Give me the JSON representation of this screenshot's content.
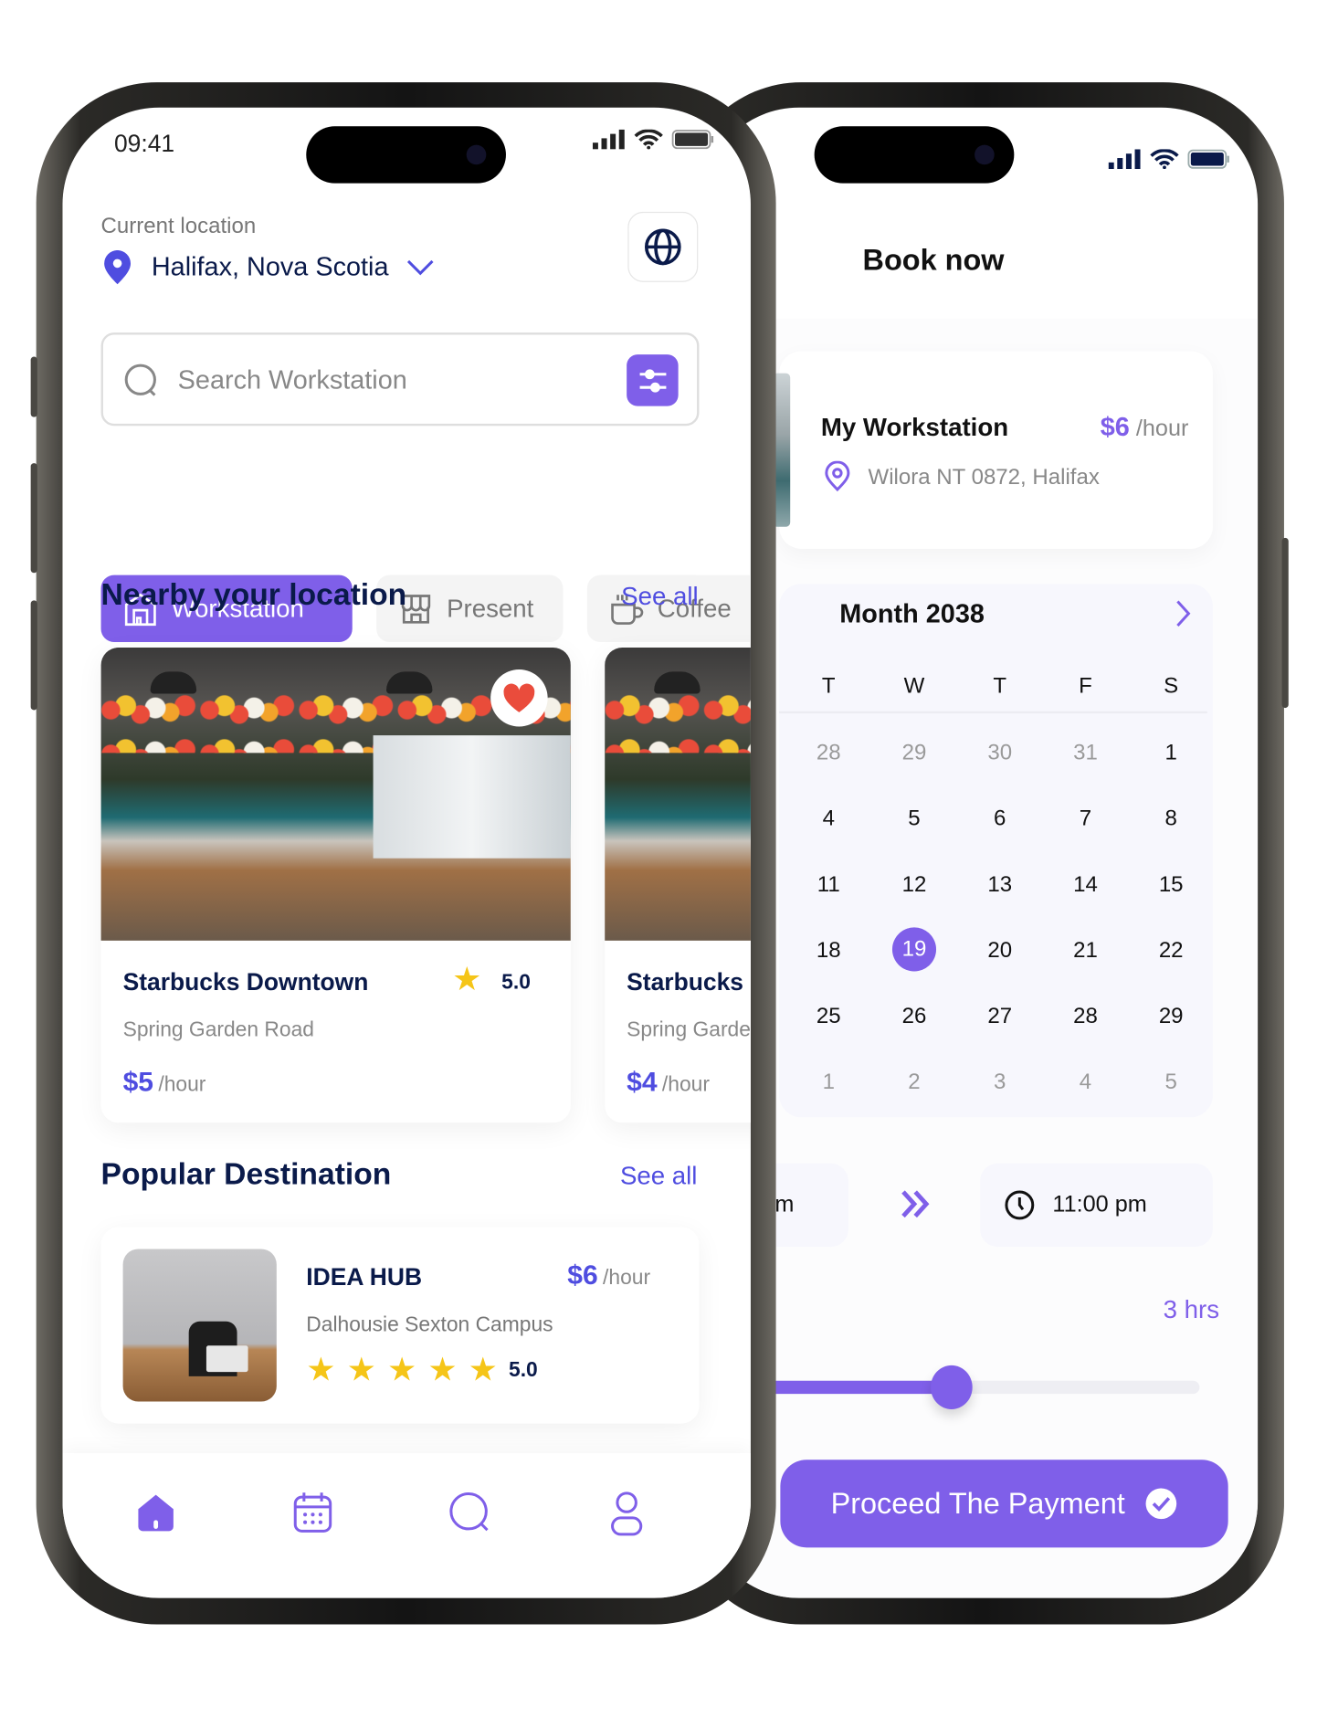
{
  "colors": {
    "accent": "#7f5fe9",
    "navy": "#0a1a4a",
    "heart": "#ea4c3c",
    "star": "#f5c518"
  },
  "left_phone": {
    "status": {
      "time": "09:41",
      "icons": [
        "signal-icon",
        "wifi-icon",
        "battery-icon"
      ]
    },
    "location": {
      "label": "Current location",
      "value": "Halifax, Nova Scotia",
      "icon": "map-pin-icon"
    },
    "globe_button": {
      "icon": "globe-icon"
    },
    "search": {
      "placeholder": "Search Workstation",
      "filter_icon": "sliders-icon"
    },
    "categories": [
      {
        "label": "Workstation",
        "icon": "building-icon",
        "selected": true
      },
      {
        "label": "Present",
        "icon": "store-icon",
        "selected": false
      },
      {
        "label": "Coffee",
        "icon": "coffee-icon",
        "selected": false
      }
    ],
    "nearby": {
      "title": "Nearby your location",
      "see_all": "See all",
      "cards": [
        {
          "name": "Starbucks Downtown",
          "rating": "5.0",
          "address": "Spring Garden Road",
          "price": "$5",
          "unit": "/hour",
          "favorite": true
        },
        {
          "name": "Starbucks",
          "address": "Spring Garde",
          "price": "$4",
          "unit": "/hour"
        }
      ]
    },
    "popular": {
      "title": "Popular Destination",
      "see_all": "See all",
      "items": [
        {
          "name": "IDEA HUB",
          "price": "$6",
          "unit": "/hour",
          "address": "Dalhousie Sexton Campus",
          "rating": "5.0",
          "stars": 5
        }
      ]
    },
    "bottom_nav": [
      {
        "icon": "home-icon",
        "active": true
      },
      {
        "icon": "calendar-icon",
        "active": false
      },
      {
        "icon": "search-icon",
        "active": false
      },
      {
        "icon": "profile-icon",
        "active": false
      }
    ]
  },
  "right_phone": {
    "title": "Book now",
    "workstation": {
      "name": "My Workstation",
      "price": "$6",
      "unit": "/hour",
      "address": "Wilora NT 0872, Halifax"
    },
    "calendar": {
      "month_label": "Month 2038",
      "weekdays": [
        "T",
        "W",
        "T",
        "F",
        "S"
      ],
      "weeks": [
        [
          {
            "d": "28",
            "m": true
          },
          {
            "d": "29",
            "m": true
          },
          {
            "d": "30",
            "m": true
          },
          {
            "d": "31",
            "m": true
          },
          {
            "d": "1"
          }
        ],
        [
          {
            "d": "4"
          },
          {
            "d": "5"
          },
          {
            "d": "6"
          },
          {
            "d": "7"
          },
          {
            "d": "8"
          }
        ],
        [
          {
            "d": "11"
          },
          {
            "d": "12"
          },
          {
            "d": "13"
          },
          {
            "d": "14"
          },
          {
            "d": "15"
          }
        ],
        [
          {
            "d": "18"
          },
          {
            "d": "19",
            "s": true
          },
          {
            "d": "20"
          },
          {
            "d": "21"
          },
          {
            "d": "22"
          }
        ],
        [
          {
            "d": "25"
          },
          {
            "d": "26"
          },
          {
            "d": "27"
          },
          {
            "d": "28"
          },
          {
            "d": "29"
          }
        ],
        [
          {
            "d": "1",
            "m": true
          },
          {
            "d": "2",
            "m": true
          },
          {
            "d": "3",
            "m": true
          },
          {
            "d": "4",
            "m": true
          },
          {
            "d": "5",
            "m": true
          }
        ]
      ],
      "selected": "19"
    },
    "time": {
      "start_partial": "m",
      "end": "11:00 pm"
    },
    "duration": {
      "label": "3 hrs",
      "slider_fraction": 0.5
    },
    "proceed_button": "Proceed The Payment"
  }
}
